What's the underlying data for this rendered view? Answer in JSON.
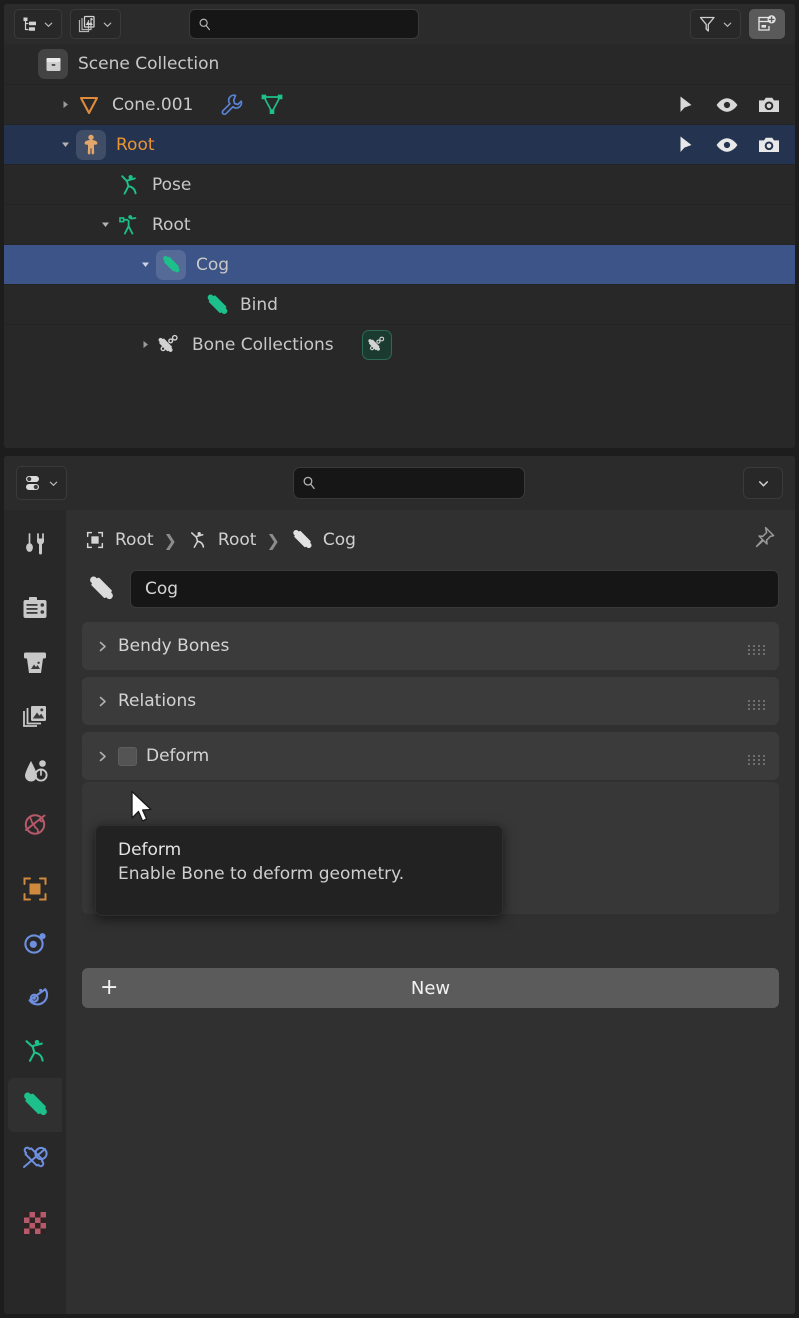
{
  "outliner": {
    "header": {
      "display_mode_icon": "outliner-display-mode-icon",
      "filter_icon": "filter-funnel-icon",
      "new_collection_icon": "new-collection-icon",
      "blend_file_icon": "blend-file-icon",
      "search_value": "",
      "search_placeholder": ""
    },
    "rows": [
      {
        "label": "Scene Collection",
        "icon": "scene-collection-icon",
        "indent": 34,
        "disclosure": "none",
        "state": "normal",
        "boxed_icon": true,
        "extra_icons": [],
        "restrict_icons": []
      },
      {
        "label": "Cone.001",
        "icon": "cone-object-icon",
        "indent": 50,
        "disclosure": "collapsed",
        "state": "normal",
        "boxed_icon": false,
        "extra_icons": [
          "modifier-wrench-icon",
          "mesh-data-icon"
        ],
        "restrict_icons": [
          "select-cursor-icon",
          "hide-eye-icon",
          "render-camera-icon"
        ]
      },
      {
        "label": "Root",
        "icon": "armature-object-icon",
        "indent": 50,
        "disclosure": "expanded",
        "state": "selected-object",
        "boxed_icon": true,
        "extra_icons": [],
        "restrict_icons": [
          "select-cursor-icon",
          "hide-eye-icon",
          "render-camera-icon"
        ]
      },
      {
        "label": "Pose",
        "icon": "pose-icon",
        "indent": 112,
        "disclosure": "none",
        "state": "normal",
        "boxed_icon": false,
        "extra_icons": [],
        "restrict_icons": []
      },
      {
        "label": "Root",
        "icon": "armature-data-icon",
        "indent": 90,
        "disclosure": "expanded",
        "state": "normal",
        "boxed_icon": false,
        "extra_icons": [],
        "restrict_icons": []
      },
      {
        "label": "Cog",
        "icon": "bone-icon",
        "indent": 130,
        "disclosure": "expanded",
        "state": "active",
        "boxed_icon": true,
        "extra_icons": [],
        "restrict_icons": []
      },
      {
        "label": "Bind",
        "icon": "bone-icon",
        "indent": 200,
        "disclosure": "none",
        "state": "normal",
        "boxed_icon": false,
        "extra_icons": [],
        "restrict_icons": []
      },
      {
        "label": "Bone Collections",
        "icon": "bone-collection-icon",
        "indent": 130,
        "disclosure": "collapsed",
        "state": "normal",
        "boxed_icon": false,
        "extra_icons": [
          "bone-collection-badge-icon"
        ],
        "restrict_icons": []
      }
    ]
  },
  "properties": {
    "header": {
      "editor_type_icon": "properties-editor-icon",
      "search_value": "",
      "search_placeholder": "",
      "options_dropdown_icon": "chevron-down-icon"
    },
    "tabs": [
      {
        "name": "tool",
        "icon": "tool-icon",
        "active": false
      },
      {
        "name": "render",
        "icon": "render-camera-back-icon",
        "active": false
      },
      {
        "name": "output",
        "icon": "output-printer-icon",
        "active": false
      },
      {
        "name": "view-layer",
        "icon": "view-layer-images-icon",
        "active": false
      },
      {
        "name": "scene",
        "icon": "scene-cone-droplet-icon",
        "active": false
      },
      {
        "name": "world",
        "icon": "world-globe-icon",
        "active": false
      },
      {
        "name": "object",
        "icon": "object-square-icon",
        "active": false
      },
      {
        "name": "modifiers",
        "icon": "physics-orbit-icon",
        "active": false
      },
      {
        "name": "particles",
        "icon": "physics-teardrop-icon",
        "active": false
      },
      {
        "name": "object-data",
        "icon": "armature-data-icon",
        "active": false
      },
      {
        "name": "bone",
        "icon": "bone-icon",
        "active": true
      },
      {
        "name": "bone-constraints",
        "icon": "bone-constraint-icon",
        "active": false
      },
      {
        "name": "texture",
        "icon": "texture-checker-icon",
        "active": false
      }
    ],
    "breadcrumb": [
      {
        "label": "Root",
        "icon": "object-square-icon"
      },
      {
        "label": "Root",
        "icon": "armature-data-icon"
      },
      {
        "label": "Cog",
        "icon": "bone-icon"
      }
    ],
    "pin_icon": "pin-icon",
    "bone_name": {
      "icon": "bone-icon",
      "value": "Cog"
    },
    "panels": [
      {
        "label": "Bendy Bones",
        "expanded": false,
        "checkbox": null
      },
      {
        "label": "Relations",
        "expanded": false,
        "checkbox": null
      },
      {
        "label": "Deform",
        "expanded": false,
        "checkbox": false
      },
      {
        "label": "",
        "expanded": false,
        "checkbox": null
      },
      {
        "label": "",
        "expanded": false,
        "checkbox": null
      }
    ],
    "new_button": {
      "label": "New",
      "icon": "plus-icon"
    }
  },
  "tooltip": {
    "title": "Deform",
    "description": "Enable Bone to deform geometry."
  },
  "colors": {
    "selected_object_row": "#233350",
    "active_row": "#3c5487",
    "accent_orange": "#eb9433",
    "bone_green": "#1dc08a",
    "panel_bg": "#3b3b3b",
    "editor_bg": "#303030"
  }
}
